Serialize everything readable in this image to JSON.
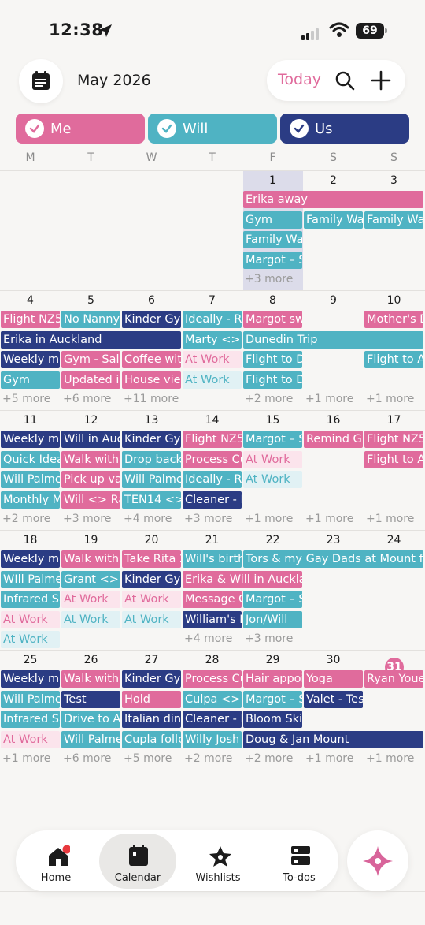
{
  "status": {
    "time": "12:38",
    "battery": "69"
  },
  "header": {
    "month": "May 2026",
    "today_label": "Today"
  },
  "filters": [
    {
      "label": "Me",
      "color": "#e06b9c"
    },
    {
      "label": "Will",
      "color": "#4fb3c3"
    },
    {
      "label": "Us",
      "color": "#2b3c84"
    }
  ],
  "weekdays": [
    "M",
    "T",
    "W",
    "T",
    "F",
    "S",
    "S"
  ],
  "weeks": [
    {
      "days": [
        "",
        "",
        "",
        "",
        "1",
        "2",
        "3"
      ],
      "today_col": 4,
      "events": [
        {
          "text": "Erika away",
          "col": 4,
          "span": 3,
          "row": 0,
          "cal": "me"
        },
        {
          "text": "Gym",
          "col": 4,
          "span": 1,
          "row": 1,
          "cal": "will"
        },
        {
          "text": "Family Wa",
          "col": 5,
          "span": 1,
          "row": 1,
          "cal": "will"
        },
        {
          "text": "Family Wa",
          "col": 6,
          "span": 1,
          "row": 1,
          "cal": "will"
        },
        {
          "text": "Family Wal",
          "col": 4,
          "span": 1,
          "row": 2,
          "cal": "will"
        },
        {
          "text": "Margot – S",
          "col": 4,
          "span": 1,
          "row": 3,
          "cal": "will"
        }
      ],
      "more": [
        "",
        "",
        "",
        "",
        "+3 more",
        "",
        ""
      ]
    },
    {
      "days": [
        "4",
        "5",
        "6",
        "7",
        "8",
        "9",
        "10"
      ],
      "events": [
        {
          "text": "Flight NZ5",
          "col": 0,
          "span": 1,
          "row": 0,
          "cal": "me"
        },
        {
          "text": "No Nanny",
          "col": 1,
          "span": 1,
          "row": 0,
          "cal": "will"
        },
        {
          "text": "Kinder Gyr",
          "col": 2,
          "span": 1,
          "row": 0,
          "cal": "us"
        },
        {
          "text": "Ideally - RS",
          "col": 3,
          "span": 1,
          "row": 0,
          "cal": "will"
        },
        {
          "text": "Margot sw",
          "col": 4,
          "span": 1,
          "row": 0,
          "cal": "me"
        },
        {
          "text": "Mother's D",
          "col": 6,
          "span": 1,
          "row": 0,
          "cal": "me"
        },
        {
          "text": "Erika in Auckland",
          "col": 0,
          "span": 3,
          "row": 1,
          "cal": "us"
        },
        {
          "text": "Marty <> W",
          "col": 3,
          "span": 1,
          "row": 1,
          "cal": "will"
        },
        {
          "text": "Dunedin Trip",
          "col": 4,
          "span": 3,
          "row": 1,
          "cal": "will"
        },
        {
          "text": "Weekly me",
          "col": 0,
          "span": 1,
          "row": 2,
          "cal": "us"
        },
        {
          "text": "Gym - Salo",
          "col": 1,
          "span": 1,
          "row": 2,
          "cal": "me"
        },
        {
          "text": "Coffee wit",
          "col": 2,
          "span": 1,
          "row": 2,
          "cal": "me"
        },
        {
          "text": "At Work",
          "col": 3,
          "span": 1,
          "row": 2,
          "cal": "mel"
        },
        {
          "text": "Flight to D",
          "col": 4,
          "span": 1,
          "row": 2,
          "cal": "will"
        },
        {
          "text": "Flight to A",
          "col": 6,
          "span": 1,
          "row": 2,
          "cal": "will"
        },
        {
          "text": "Gym",
          "col": 0,
          "span": 1,
          "row": 3,
          "cal": "will"
        },
        {
          "text": "Updated in",
          "col": 1,
          "span": 1,
          "row": 3,
          "cal": "me"
        },
        {
          "text": "House view",
          "col": 2,
          "span": 1,
          "row": 3,
          "cal": "me"
        },
        {
          "text": "At Work",
          "col": 3,
          "span": 1,
          "row": 3,
          "cal": "willl"
        },
        {
          "text": "Flight to D",
          "col": 4,
          "span": 1,
          "row": 3,
          "cal": "will"
        }
      ],
      "more": [
        "+5 more",
        "+6 more",
        "+11 more",
        "",
        "+2 more",
        "+1 more",
        "+1 more"
      ]
    },
    {
      "days": [
        "11",
        "12",
        "13",
        "14",
        "15",
        "16",
        "17"
      ],
      "events": [
        {
          "text": "Weekly me",
          "col": 0,
          "span": 1,
          "row": 0,
          "cal": "us"
        },
        {
          "text": "Will in Auc",
          "col": 1,
          "span": 1,
          "row": 0,
          "cal": "us"
        },
        {
          "text": "Kinder Gyr",
          "col": 2,
          "span": 1,
          "row": 0,
          "cal": "us"
        },
        {
          "text": "Flight NZ5",
          "col": 3,
          "span": 1,
          "row": 0,
          "cal": "me"
        },
        {
          "text": "Margot – S",
          "col": 4,
          "span": 1,
          "row": 0,
          "cal": "will"
        },
        {
          "text": "Remind Gr",
          "col": 5,
          "span": 1,
          "row": 0,
          "cal": "me"
        },
        {
          "text": "Flight NZ5",
          "col": 6,
          "span": 1,
          "row": 0,
          "cal": "me"
        },
        {
          "text": "Quick Idea",
          "col": 0,
          "span": 1,
          "row": 1,
          "cal": "will"
        },
        {
          "text": "Walk with",
          "col": 1,
          "span": 1,
          "row": 1,
          "cal": "me"
        },
        {
          "text": "Drop back",
          "col": 2,
          "span": 1,
          "row": 1,
          "cal": "will"
        },
        {
          "text": "Process Cu",
          "col": 3,
          "span": 1,
          "row": 1,
          "cal": "me"
        },
        {
          "text": "At Work",
          "col": 4,
          "span": 1,
          "row": 1,
          "cal": "mel"
        },
        {
          "text": "Flight to A",
          "col": 6,
          "span": 1,
          "row": 1,
          "cal": "me"
        },
        {
          "text": "Will Palme",
          "col": 0,
          "span": 1,
          "row": 2,
          "cal": "will"
        },
        {
          "text": "Pick up va",
          "col": 1,
          "span": 1,
          "row": 2,
          "cal": "me"
        },
        {
          "text": "Will Palme",
          "col": 2,
          "span": 1,
          "row": 2,
          "cal": "will"
        },
        {
          "text": "Ideally - RS",
          "col": 3,
          "span": 1,
          "row": 2,
          "cal": "will"
        },
        {
          "text": "At Work",
          "col": 4,
          "span": 1,
          "row": 2,
          "cal": "willl"
        },
        {
          "text": "Monthly M",
          "col": 0,
          "span": 1,
          "row": 3,
          "cal": "will"
        },
        {
          "text": "Will <> Rafe",
          "col": 1,
          "span": 1,
          "row": 3,
          "cal": "me"
        },
        {
          "text": "TEN14 <> W",
          "col": 2,
          "span": 1,
          "row": 3,
          "cal": "will"
        },
        {
          "text": "Cleaner - M",
          "col": 3,
          "span": 1,
          "row": 3,
          "cal": "us"
        }
      ],
      "more": [
        "+2 more",
        "+3 more",
        "+4 more",
        "+3 more",
        "+1 more",
        "+1 more",
        "+1 more"
      ]
    },
    {
      "days": [
        "18",
        "19",
        "20",
        "21",
        "22",
        "23",
        "24"
      ],
      "events": [
        {
          "text": "Weekly me",
          "col": 0,
          "span": 1,
          "row": 0,
          "cal": "us"
        },
        {
          "text": "Walk with",
          "col": 1,
          "span": 1,
          "row": 0,
          "cal": "me"
        },
        {
          "text": "Take Rita 2",
          "col": 2,
          "span": 1,
          "row": 0,
          "cal": "me"
        },
        {
          "text": "Will's birth",
          "col": 3,
          "span": 1,
          "row": 0,
          "cal": "will"
        },
        {
          "text": "Tors & my Gay Dads at Mount for",
          "col": 4,
          "span": 3,
          "row": 0,
          "cal": "will"
        },
        {
          "text": "WIll Palme",
          "col": 0,
          "span": 1,
          "row": 1,
          "cal": "will"
        },
        {
          "text": "Grant <> W",
          "col": 1,
          "span": 1,
          "row": 1,
          "cal": "will"
        },
        {
          "text": "Kinder Gyr",
          "col": 2,
          "span": 1,
          "row": 1,
          "cal": "us"
        },
        {
          "text": "Erika & Will in Aucklan",
          "col": 3,
          "span": 2,
          "row": 1,
          "cal": "me"
        },
        {
          "text": "Infrared Sa",
          "col": 0,
          "span": 1,
          "row": 2,
          "cal": "will"
        },
        {
          "text": "At Work",
          "col": 1,
          "span": 1,
          "row": 2,
          "cal": "mel"
        },
        {
          "text": "At Work",
          "col": 2,
          "span": 1,
          "row": 2,
          "cal": "mel"
        },
        {
          "text": "Message G",
          "col": 3,
          "span": 1,
          "row": 2,
          "cal": "me"
        },
        {
          "text": "Margot – S",
          "col": 4,
          "span": 1,
          "row": 2,
          "cal": "will"
        },
        {
          "text": "At Work",
          "col": 0,
          "span": 1,
          "row": 3,
          "cal": "mel"
        },
        {
          "text": "At Work",
          "col": 1,
          "span": 1,
          "row": 3,
          "cal": "willl"
        },
        {
          "text": "At Work",
          "col": 2,
          "span": 1,
          "row": 3,
          "cal": "willl"
        },
        {
          "text": "William's B",
          "col": 3,
          "span": 1,
          "row": 3,
          "cal": "us"
        },
        {
          "text": "Jon/Will",
          "col": 4,
          "span": 1,
          "row": 3,
          "cal": "will"
        },
        {
          "text": "At Work",
          "col": 0,
          "span": 1,
          "row": 4,
          "cal": "willl"
        }
      ],
      "more": [
        "",
        "",
        "",
        "+4 more",
        "+3 more",
        "",
        ""
      ]
    },
    {
      "days": [
        "25",
        "26",
        "27",
        "28",
        "29",
        "30",
        "31"
      ],
      "today_circle_col": 6,
      "events": [
        {
          "text": "Weekly me",
          "col": 0,
          "span": 1,
          "row": 0,
          "cal": "us"
        },
        {
          "text": "Walk with",
          "col": 1,
          "span": 1,
          "row": 0,
          "cal": "me"
        },
        {
          "text": "Kinder Gyr",
          "col": 2,
          "span": 1,
          "row": 0,
          "cal": "us"
        },
        {
          "text": "Process Cu",
          "col": 3,
          "span": 1,
          "row": 0,
          "cal": "me"
        },
        {
          "text": "Hair appoi",
          "col": 4,
          "span": 1,
          "row": 0,
          "cal": "me"
        },
        {
          "text": "Yoga",
          "col": 5,
          "span": 1,
          "row": 0,
          "cal": "me"
        },
        {
          "text": "Ryan Youe",
          "col": 6,
          "span": 1,
          "row": 0,
          "cal": "me"
        },
        {
          "text": "Will Palme",
          "col": 0,
          "span": 1,
          "row": 1,
          "cal": "will"
        },
        {
          "text": "Test",
          "col": 1,
          "span": 1,
          "row": 1,
          "cal": "us"
        },
        {
          "text": "Hold",
          "col": 2,
          "span": 1,
          "row": 1,
          "cal": "me"
        },
        {
          "text": "Culpa <> Ti",
          "col": 3,
          "span": 1,
          "row": 1,
          "cal": "will"
        },
        {
          "text": "Margot – S",
          "col": 4,
          "span": 1,
          "row": 1,
          "cal": "will"
        },
        {
          "text": "Valet - Tes",
          "col": 5,
          "span": 1,
          "row": 1,
          "cal": "us"
        },
        {
          "text": "Infrared Sa",
          "col": 0,
          "span": 1,
          "row": 2,
          "cal": "will"
        },
        {
          "text": "Drive to Au",
          "col": 1,
          "span": 1,
          "row": 2,
          "cal": "will"
        },
        {
          "text": "Italian dinr",
          "col": 2,
          "span": 1,
          "row": 2,
          "cal": "us"
        },
        {
          "text": "Cleaner - M",
          "col": 3,
          "span": 1,
          "row": 2,
          "cal": "us"
        },
        {
          "text": "Bloom Skir",
          "col": 4,
          "span": 1,
          "row": 2,
          "cal": "us"
        },
        {
          "text": "At Work",
          "col": 0,
          "span": 1,
          "row": 3,
          "cal": "mel"
        },
        {
          "text": "Will Palme",
          "col": 1,
          "span": 1,
          "row": 3,
          "cal": "will"
        },
        {
          "text": "Cupla follc",
          "col": 2,
          "span": 1,
          "row": 3,
          "cal": "will"
        },
        {
          "text": "Willy Josh",
          "col": 3,
          "span": 1,
          "row": 3,
          "cal": "will"
        },
        {
          "text": "Doug & Jan Mount",
          "col": 4,
          "span": 3,
          "row": 3,
          "cal": "us"
        }
      ],
      "more": [
        "+1 more",
        "+6 more",
        "+5 more",
        "+2 more",
        "+2 more",
        "+1 more",
        "+1 more"
      ]
    }
  ],
  "nav": [
    {
      "label": "Home",
      "icon": "home-icon",
      "active": false,
      "badge": true
    },
    {
      "label": "Calendar",
      "icon": "calendar-icon",
      "active": true
    },
    {
      "label": "Wishlists",
      "icon": "star-icon",
      "active": false
    },
    {
      "label": "To-dos",
      "icon": "todo-icon",
      "active": false
    }
  ],
  "fab_icon": "sparkle-icon",
  "colors": {
    "me": "#e06b9c",
    "will": "#4fb3c3",
    "us": "#2b3c84",
    "today_col": "#dcdcea"
  }
}
